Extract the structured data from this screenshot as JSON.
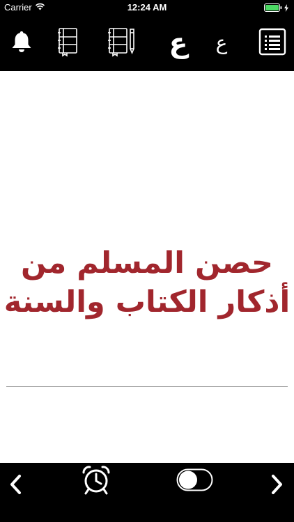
{
  "status": {
    "carrier": "Carrier",
    "time": "12:24 AM"
  },
  "toolbar": {
    "font_large_letter": "ع",
    "font_small_letter": "ع",
    "icons": [
      "bell-icon",
      "notebook-icon",
      "notebook-pen-icon",
      "increase-font-icon",
      "decrease-font-icon",
      "list-menu-icon"
    ]
  },
  "main": {
    "title_line1": "حصن المسلم من",
    "title_line2": "أذكار الكتاب والسنة",
    "title_color": "#a1262d"
  },
  "bottom": {
    "icons": [
      "chevron-left-icon",
      "alarm-clock-icon",
      "toggle-switch",
      "chevron-right-icon"
    ],
    "toggle_on": false
  }
}
